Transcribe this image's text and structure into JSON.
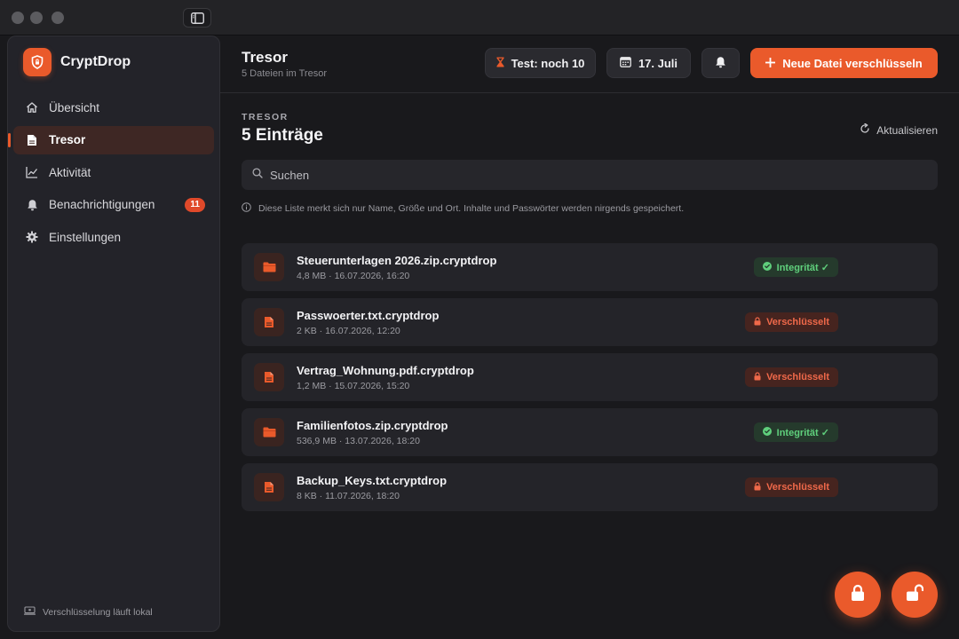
{
  "colors": {
    "accent": "#ea5a2b",
    "success": "#5fcf7c",
    "danger": "#f0694a",
    "badge": "#e0492a"
  },
  "app": {
    "name": "CryptDrop"
  },
  "sidebar": {
    "items": [
      {
        "label": "Übersicht",
        "icon": "home-icon",
        "active": false
      },
      {
        "label": "Tresor",
        "icon": "file-icon",
        "active": true
      },
      {
        "label": "Aktivität",
        "icon": "chart-icon",
        "active": false
      },
      {
        "label": "Benachrichtigungen",
        "icon": "bell-icon",
        "active": false,
        "badge": "11"
      },
      {
        "label": "Einstellungen",
        "icon": "gear-icon",
        "active": false
      }
    ],
    "footer": "Verschlüsselung läuft lokal"
  },
  "header": {
    "title": "Tresor",
    "subtitle": "5 Dateien im Tresor",
    "trial": "Test: noch 10",
    "date": "17. Juli",
    "new_button": "Neue Datei verschlüsseln"
  },
  "section": {
    "label": "TRESOR",
    "title": "5 Einträge",
    "refresh": "Aktualisieren"
  },
  "search": {
    "placeholder": "Suchen",
    "value": ""
  },
  "note": "Diese Liste merkt sich nur Name, Größe und Ort. Inhalte und Passwörter werden nirgends gespeichert.",
  "files": [
    {
      "name": "Steuerunterlagen 2026.zip.cryptdrop",
      "meta": "4,8 MB · 16.07.2026, 16:20",
      "type": "folder",
      "status": "Integrität ✓",
      "status_kind": "ok"
    },
    {
      "name": "Passwoerter.txt.cryptdrop",
      "meta": "2 KB · 16.07.2026, 12:20",
      "type": "file",
      "status": "Verschlüsselt",
      "status_kind": "enc"
    },
    {
      "name": "Vertrag_Wohnung.pdf.cryptdrop",
      "meta": "1,2 MB · 15.07.2026, 15:20",
      "type": "file",
      "status": "Verschlüsselt",
      "status_kind": "enc"
    },
    {
      "name": "Familienfotos.zip.cryptdrop",
      "meta": "536,9 MB · 13.07.2026, 18:20",
      "type": "folder",
      "status": "Integrität ✓",
      "status_kind": "ok"
    },
    {
      "name": "Backup_Keys.txt.cryptdrop",
      "meta": "8 KB · 11.07.2026, 18:20",
      "type": "file",
      "status": "Verschlüsselt",
      "status_kind": "enc"
    }
  ]
}
